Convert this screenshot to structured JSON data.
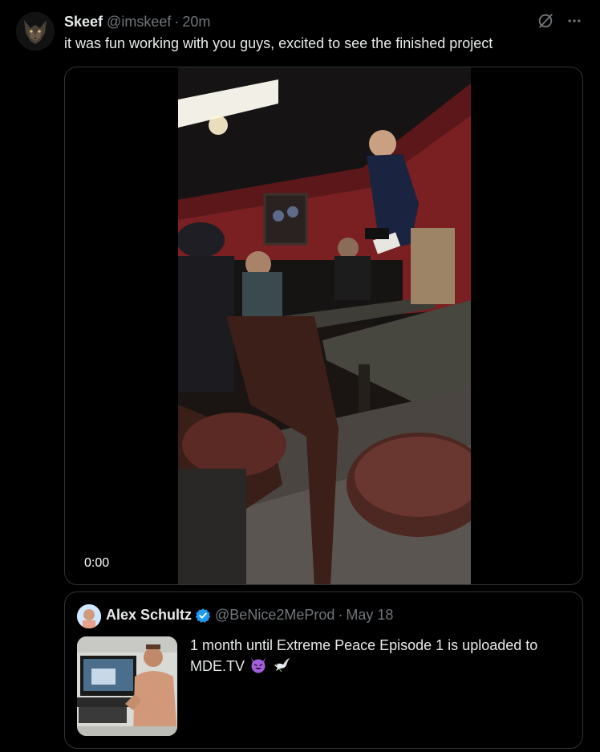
{
  "tweet": {
    "author": {
      "display_name": "Skeef",
      "handle": "@imskeef",
      "avatar_icon": "wolf-avatar"
    },
    "separator": "·",
    "time": "20m",
    "text": "it was fun working with you guys, excited to see the finished project",
    "actions": {
      "grok_icon": "grok-icon",
      "more_icon": "more-icon"
    },
    "media": {
      "type": "video",
      "timestamp": "0:00"
    }
  },
  "quote": {
    "author": {
      "display_name": "Alex Schultz",
      "handle": "@BeNice2MeProd",
      "verified": true,
      "verified_color": "#1d9bf0"
    },
    "separator": "·",
    "time": "May 18",
    "text": "1 month until Extreme Peace Episode 1 is uploaded to MDE.TV",
    "emojis": [
      "smiling-devil-emoji",
      "dove-emoji"
    ]
  },
  "colors": {
    "background": "#000000",
    "text_primary": "#e7e9ea",
    "text_secondary": "#71767b",
    "border": "#2f3336",
    "verified": "#1d9bf0"
  }
}
